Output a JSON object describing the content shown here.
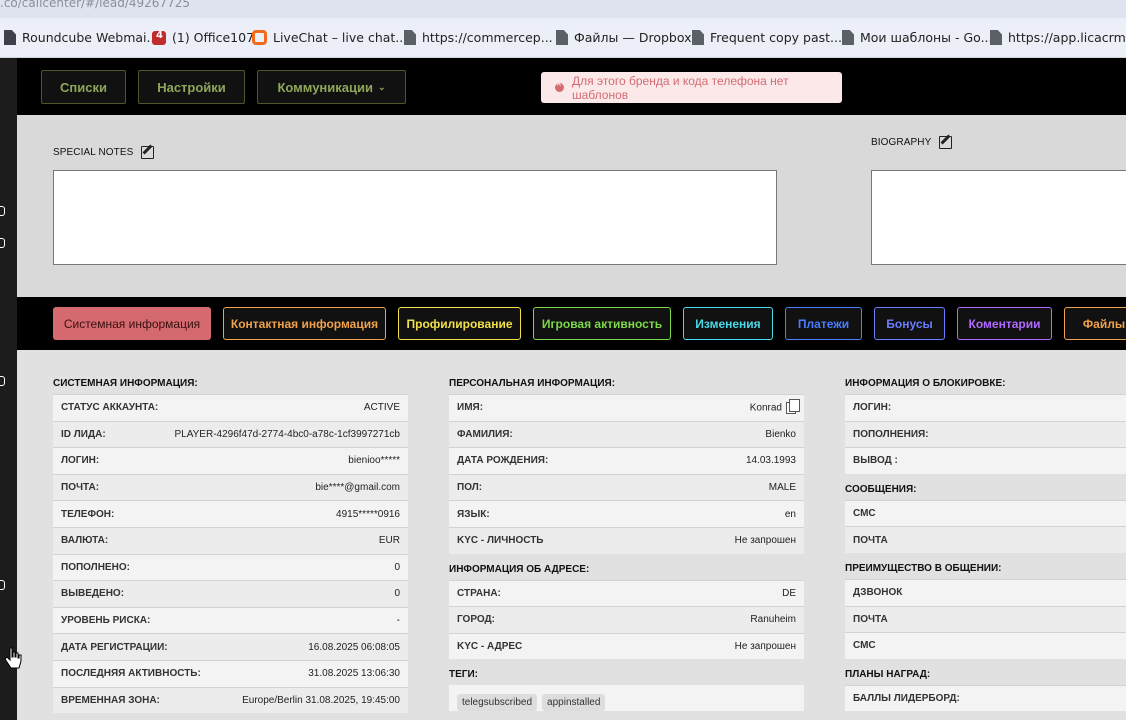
{
  "browser": {
    "url": ".co/callcenter/#/lead/49267725",
    "bookmarks": [
      "Roundcube Webmai...",
      "(1) Office107",
      "LiveChat – live chat...",
      "https://commercep...",
      "Файлы — Dropbox",
      "Frequent copy past...",
      "Мои шаблоны - Go...",
      "https://app.licacrm...."
    ]
  },
  "nav": {
    "buttons": [
      "Списки",
      "Настройки",
      "Коммуникации"
    ],
    "chevron": "chevron-down-icon",
    "toast": "Для этого бренда и кода телефона нет шаблонов"
  },
  "notes": {
    "special_label": "SPECIAL NOTES",
    "bio_label": "BIOGRAPHY"
  },
  "tabs": [
    {
      "label": "Системная информация",
      "color": "#d46a6f"
    },
    {
      "label": "Контактная информация",
      "color": "#f0a24a"
    },
    {
      "label": "Профилирование",
      "color": "#f0e04a"
    },
    {
      "label": "Игровая активность",
      "color": "#7dd84a"
    },
    {
      "label": "Изменения",
      "color": "#4ad8e8"
    },
    {
      "label": "Платежи",
      "color": "#4a7dff"
    },
    {
      "label": "Бонусы",
      "color": "#6a7dff"
    },
    {
      "label": "Коментарии",
      "color": "#b06aff"
    },
    {
      "label": "Файлы",
      "color": "#f0a24a"
    }
  ],
  "system": {
    "title": "СИСТЕМНАЯ ИНФОРМАЦИЯ:",
    "rows": [
      {
        "label": "СТАТУС АККАУНТА:",
        "value": "ACTIVE"
      },
      {
        "label": "ID ЛИДА:",
        "value": "PLAYER-4296f47d-2774-4bc0-a78c-1cf3997271cb"
      },
      {
        "label": "ЛОГИН:",
        "value": "bienioo*****"
      },
      {
        "label": "ПОЧТА:",
        "value": "bie****@gmail.com"
      },
      {
        "label": "ТЕЛЕФОН:",
        "value": "4915*****0916"
      },
      {
        "label": "ВАЛЮТА:",
        "value": "EUR"
      },
      {
        "label": "ПОПОЛНЕНО:",
        "value": "0"
      },
      {
        "label": "ВЫВЕДЕНО:",
        "value": "0"
      },
      {
        "label": "УРОВЕНЬ РИСКА:",
        "value": "-"
      },
      {
        "label": "ДАТА РЕГИСТРАЦИИ:",
        "value": "16.08.2025 06:08:05"
      },
      {
        "label": "ПОСЛЕДНЯЯ АКТИВНОСТЬ:",
        "value": "31.08.2025 13:06:30"
      },
      {
        "label": "ВРЕМЕННАЯ ЗОНА:",
        "value": "Europe/Berlin 31.08.2025, 19:45:00"
      }
    ]
  },
  "personal": {
    "title": "ПЕРСОНАЛЬНАЯ ИНФОРМАЦИЯ:",
    "rows": [
      {
        "label": "ИМЯ:",
        "value": "Konrad"
      },
      {
        "label": "ФАМИЛИЯ:",
        "value": "Bienko"
      },
      {
        "label": "ДАТА РОЖДЕНИЯ:",
        "value": "14.03.1993"
      },
      {
        "label": "ПОЛ:",
        "value": "MALE"
      },
      {
        "label": "ЯЗЫК:",
        "value": "en"
      },
      {
        "label": "KYC - ЛИЧНОСТЬ",
        "value": "Не запрошен"
      }
    ],
    "address_title": "ИНФОРМАЦИЯ ОБ АДРЕСЕ:",
    "address_rows": [
      {
        "label": "СТРАНА:",
        "value": "DE"
      },
      {
        "label": "ГОРОД:",
        "value": "Ranuheim"
      },
      {
        "label": "KYC - АДРЕС",
        "value": "Не запрошен"
      }
    ],
    "tags_title": "ТЕГИ:",
    "tags": [
      "telegsubscribed",
      "appinstalled"
    ]
  },
  "blocking": {
    "title": "ИНФОРМАЦИЯ О БЛОКИРОВКЕ:",
    "rows": [
      {
        "label": "ЛОГИН:"
      },
      {
        "label": "ПОПОЛНЕНИЯ:"
      },
      {
        "label": "ВЫВОД :"
      }
    ],
    "messages_title": "СООБЩЕНИЯ:",
    "messages_rows": [
      {
        "label": "СМС"
      },
      {
        "label": "ПОЧТА"
      }
    ],
    "pref_title": "ПРЕИМУЩЕСТВО В ОБЩЕНИИ:",
    "pref_rows": [
      {
        "label": "ДЗВОНОК"
      },
      {
        "label": "ПОЧТА"
      },
      {
        "label": "СМС"
      }
    ],
    "rewards_title": "ПЛАНЫ НАГРАД:",
    "rewards_rows": [
      {
        "label": "БАЛЛЫ ЛИДЕРБОРД:"
      }
    ]
  }
}
